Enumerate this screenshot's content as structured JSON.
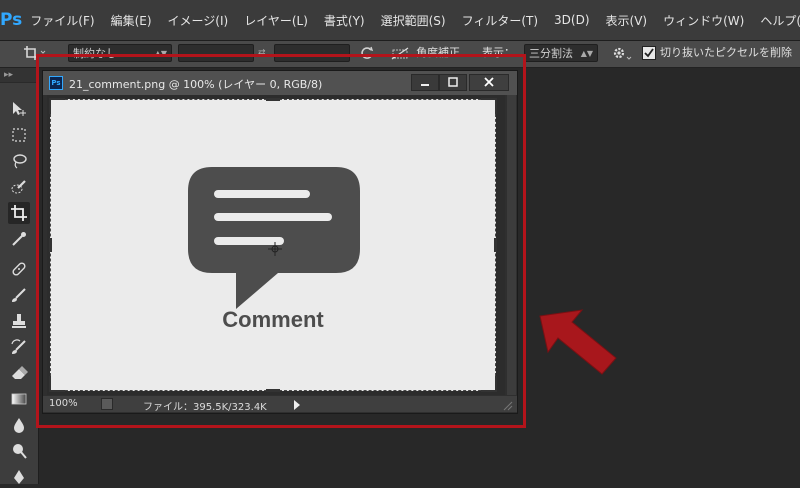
{
  "app": {
    "logo": "Ps"
  },
  "menu": [
    "ファイル(F)",
    "編集(E)",
    "イメージ(I)",
    "レイヤー(L)",
    "書式(Y)",
    "選択範囲(S)",
    "フィルター(T)",
    "3D(D)",
    "表示(V)",
    "ウィンドウ(W)",
    "ヘルプ(H)"
  ],
  "options": {
    "ratio_value": "制約なし",
    "angle_label": "角度補正",
    "view_label": "表示：",
    "overlay_value": "三分割法",
    "delete_pixels_label": "切り抜いたピクセルを削除",
    "delete_pixels_checked": true
  },
  "document": {
    "ps_badge": "Ps",
    "title": "21_comment.png @ 100% (レイヤー 0, RGB/8)",
    "canvas_caption": "Comment",
    "zoom": "100%",
    "file_info": "ファイル：395.5K/323.4K"
  },
  "colors": {
    "annotation_red": "#b3141b",
    "icon_gray": "#4d4d4d",
    "canvas_bg": "#ebebeb",
    "ps_blue": "#31a8ff"
  },
  "icons": {
    "annotation": "red-arrow",
    "canvas_graphic": "speech-bubble-icon"
  }
}
